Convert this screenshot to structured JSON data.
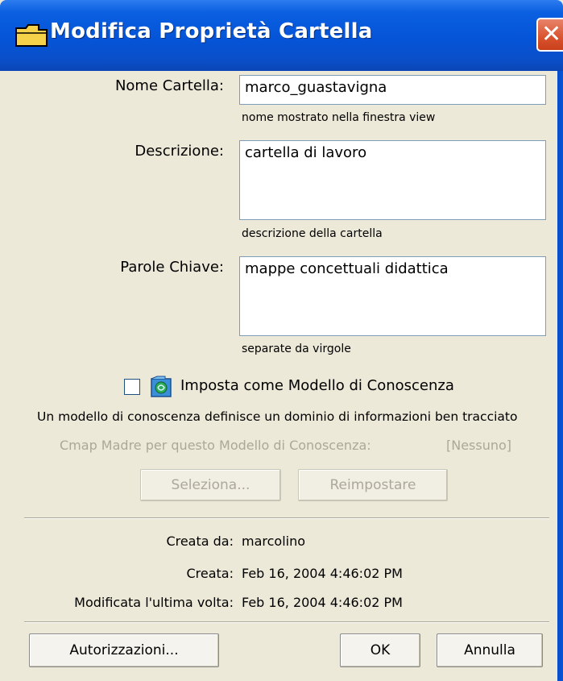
{
  "window": {
    "title": "Modifica Proprietà Cartella",
    "icon": "folder-icon",
    "close_icon": "close-icon",
    "accent_color": "#0554d8"
  },
  "fields": {
    "name_label": "Nome Cartella:",
    "name_value": "marco_guastavigna",
    "name_hint": "nome mostrato nella finestra view",
    "description_label": "Descrizione:",
    "description_value": "cartella di lavoro",
    "description_hint": "descrizione della cartella",
    "keywords_label": "Parole Chiave:",
    "keywords_value": "mappe concettuali didattica",
    "keywords_hint": "separate da virgole"
  },
  "knowledge_model": {
    "checkbox_label": "Imposta come Modello di Conoscenza",
    "checked": false,
    "description": "Un modello di conoscenza definisce un dominio di informazioni ben tracciato",
    "parent_label": "Cmap Madre per questo Modello di Conoscenza:",
    "parent_value": "[Nessuno]",
    "select_button": "Seleziona...",
    "reset_button": "Reimpostare"
  },
  "info": {
    "created_by_label": "Creata da:",
    "created_by_value": "marcolino",
    "created_label": "Creata:",
    "created_value": "Feb 16, 2004 4:46:02 PM",
    "modified_label": "Modificata l'ultima volta:",
    "modified_value": "Feb 16, 2004 4:46:02 PM"
  },
  "buttons": {
    "permissions": "Autorizzazioni...",
    "ok": "OK",
    "cancel": "Annulla"
  }
}
